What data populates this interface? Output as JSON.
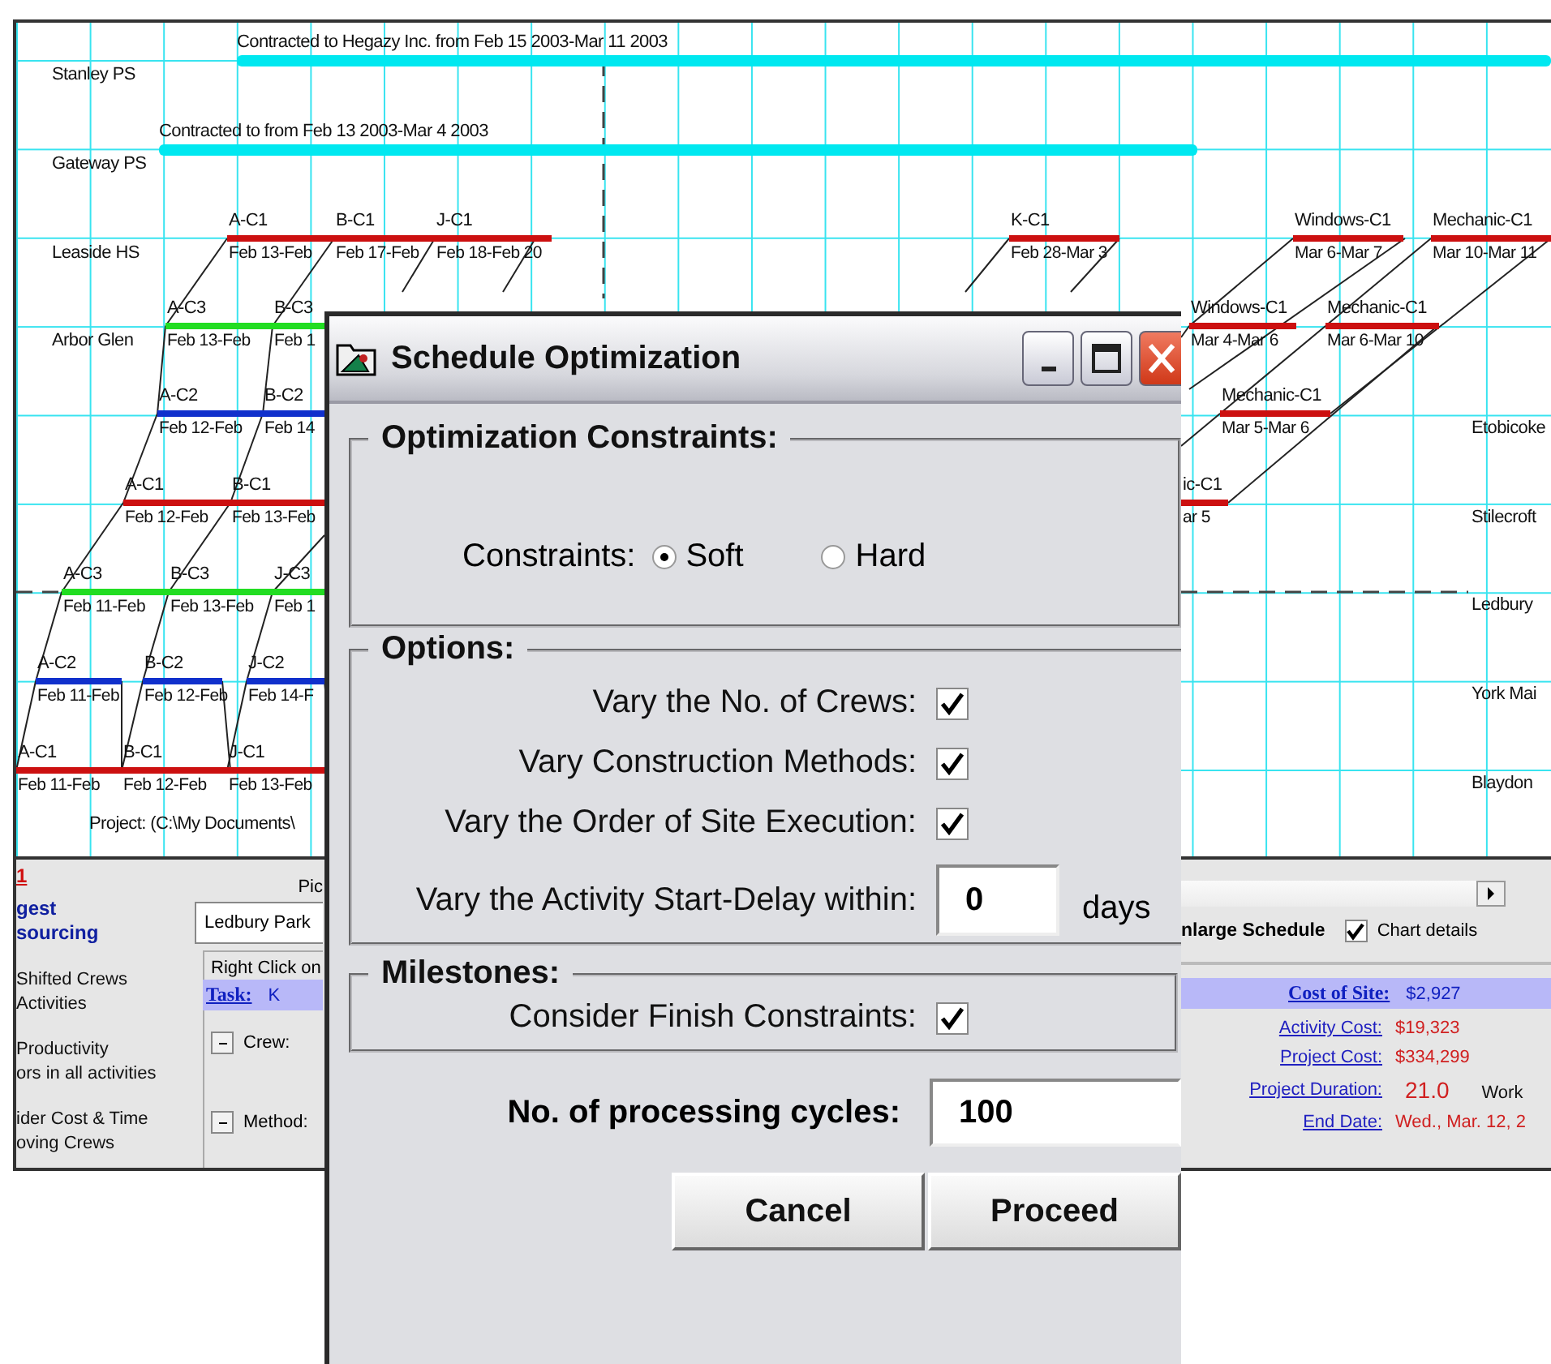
{
  "chart": {
    "site_rows": [
      {
        "name": "Stanley PS"
      },
      {
        "name": "Gateway PS"
      },
      {
        "name": "Leaside HS"
      },
      {
        "name": "Arbor Glen"
      }
    ],
    "side_rows": [
      {
        "name": "Etobicoke"
      },
      {
        "name": "Stilecroft"
      },
      {
        "name": "Ledbury"
      },
      {
        "name": "York Mai"
      },
      {
        "name": "Blaydon"
      }
    ],
    "contracts": [
      {
        "text": "Contracted to Hegazy Inc. from Feb 15 2003-Mar 11 2003",
        "color": "#00e8f0"
      },
      {
        "text": "Contracted to  from Feb 13 2003-Mar 4 2003",
        "color": "#00e8f0"
      }
    ],
    "tasks": [
      {
        "label": "A-C1",
        "dates": "Feb 13-Feb",
        "color": "#cc1010"
      },
      {
        "label": "B-C1",
        "dates": "Feb 17-Feb",
        "color": "#cc1010"
      },
      {
        "label": "J-C1",
        "dates": "Feb 18-Feb 20",
        "color": "#cc1010"
      },
      {
        "label": "K-C1",
        "dates": "Feb 28-Mar 3",
        "color": "#cc1010"
      },
      {
        "label": "Windows-C1",
        "dates": "Mar 6-Mar 7",
        "color": "#cc1010"
      },
      {
        "label": "Mechanic-C1",
        "dates": "Mar 10-Mar 11",
        "color": "#cc1010"
      },
      {
        "label": "A-C3",
        "dates": "Feb 13-Feb",
        "color": "#22dd22"
      },
      {
        "label": "B-C3",
        "dates": "Feb 1",
        "color": "#22dd22"
      },
      {
        "label": "Windows-C1",
        "dates": "Mar 4-Mar 6",
        "color": "#cc1010"
      },
      {
        "label": "Mechanic-C1",
        "dates": "Mar 6-Mar 10",
        "color": "#cc1010"
      },
      {
        "label": "A-C2",
        "dates": "Feb 12-Feb",
        "color": "#1030cc"
      },
      {
        "label": "B-C2",
        "dates": "Feb 14",
        "color": "#1030cc"
      },
      {
        "label": "Mechanic-C1",
        "dates": "Mar 5-Mar 6",
        "color": "#cc1010"
      },
      {
        "label": "A-C1",
        "dates": "Feb 12-Feb",
        "color": "#cc1010"
      },
      {
        "label": "B-C1",
        "dates": "Feb 13-Feb",
        "color": "#cc1010"
      },
      {
        "label": "ic-C1",
        "dates": "ar 5",
        "color": "#cc1010"
      },
      {
        "label": "A-C3",
        "dates": "Feb 11-Feb",
        "color": "#22dd22"
      },
      {
        "label": "B-C3",
        "dates": "Feb 13-Feb",
        "color": "#22dd22"
      },
      {
        "label": "J-C3",
        "dates": "Feb 1",
        "color": "#22dd22"
      },
      {
        "label": "A-C2",
        "dates": "Feb 11-Feb",
        "color": "#1030cc"
      },
      {
        "label": "B-C2",
        "dates": "Feb 12-Feb",
        "color": "#1030cc"
      },
      {
        "label": "J-C2",
        "dates": "Feb 14-F",
        "color": "#1030cc"
      },
      {
        "label": "A-C1",
        "dates": "Feb 11-Feb",
        "color": "#cc1010"
      },
      {
        "label": "B-C1",
        "dates": "Feb 12-Feb",
        "color": "#cc1010"
      },
      {
        "label": "J-C1",
        "dates": "Feb 13-Feb",
        "color": "#cc1010"
      }
    ],
    "project_path": "Project: (C:\\My Documents\\"
  },
  "panel": {
    "step_link": "1",
    "heading_lines": [
      "gest",
      "sourcing"
    ],
    "options": [
      {
        "lines": [
          "Shifted Crews",
          "Activities"
        ]
      },
      {
        "lines": [
          "Productivity",
          "ors in all activities"
        ]
      },
      {
        "lines": [
          "ider Cost & Time",
          "oving Crews"
        ]
      }
    ],
    "pick_label": "Pic",
    "site_field": "Ledbury Park",
    "hint": "Right Click on",
    "task_label": "Task:",
    "task_value": "K",
    "crew_label": "Crew:",
    "method_label": "Method:",
    "enlarge_label": "nlarge Schedule",
    "chart_details": {
      "label": "Chart details",
      "checked": true
    },
    "cost_of_site": {
      "label": "Cost of Site:",
      "value": "$2,927"
    },
    "stats": [
      {
        "label": "Activity Cost:",
        "value": "$19,323"
      },
      {
        "label": "Project Cost:",
        "value": "$334,299"
      },
      {
        "label": "Project Duration:",
        "value": "21.0",
        "unit": "Work"
      },
      {
        "label": "End Date:",
        "value": "Wed., Mar. 12, 2"
      }
    ]
  },
  "dialog": {
    "title": "Schedule Optimization",
    "constraints_group": {
      "title": "Optimization Constraints:",
      "label": "Constraints:",
      "choices": [
        {
          "label": "Soft",
          "selected": true
        },
        {
          "label": "Hard",
          "selected": false
        }
      ]
    },
    "options_group": {
      "title": "Options:",
      "items": [
        {
          "kind": "checkbox",
          "label": "Vary the No. of Crews:",
          "checked": true
        },
        {
          "kind": "checkbox",
          "label": "Vary Construction Methods:",
          "checked": true
        },
        {
          "kind": "checkbox",
          "label": "Vary the Order of Site Execution:",
          "checked": true
        },
        {
          "kind": "number",
          "label": "Vary the Activity Start-Delay within:",
          "value": "0",
          "unit": "days"
        }
      ]
    },
    "milestones_group": {
      "title": "Milestones:",
      "items": [
        {
          "kind": "checkbox",
          "label": "Consider Finish Constraints:",
          "checked": true
        }
      ]
    },
    "cycles": {
      "label": "No. of processing cycles:",
      "value": "100"
    },
    "buttons": [
      "Cancel",
      "Proceed"
    ]
  }
}
